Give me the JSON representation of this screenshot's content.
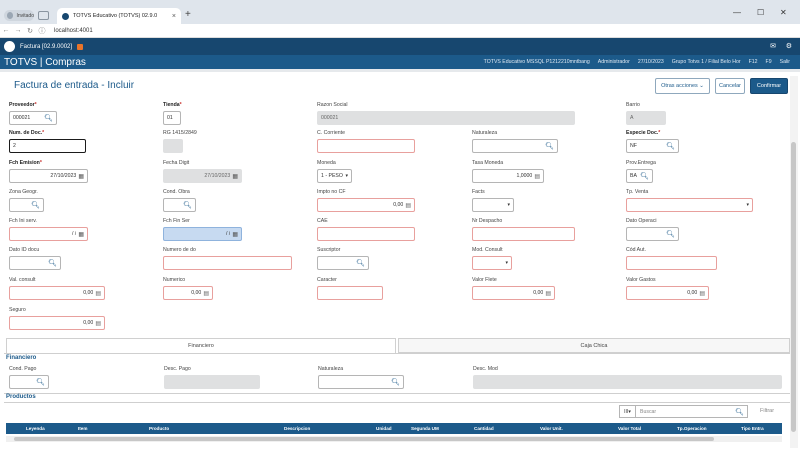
{
  "browser": {
    "profile_label": "Invitado",
    "tab_title": "TOTVS Educativo (TOTVS) 02.9.0",
    "tab_close": "×",
    "new_tab": "+",
    "url": "localhost:4001"
  },
  "app": {
    "window_title": "Factura [02.9.0002]",
    "brand": "TOTVS | Compras",
    "env_info": [
      "TOTVS Educativo MSSQL P1212210mntbang",
      "Administrador",
      "27/10/2023",
      "Grupo Totvs 1 / Filial Belo Hor",
      "F12",
      "F9",
      "Salir"
    ]
  },
  "page": {
    "title": "Factura de entrada - Incluir",
    "buttons": {
      "more_actions": "Otras acciones",
      "cancel": "Cancelar",
      "confirm": "Confirmar"
    }
  },
  "form": {
    "proveedor": {
      "label": "Proveedor",
      "value": "000021"
    },
    "tienda": {
      "label": "Tienda",
      "value": "01"
    },
    "razon_social": {
      "label": "Razon Social",
      "value": "000021"
    },
    "barrio": {
      "label": "Barrio",
      "value": "A"
    },
    "num_doc": {
      "label": "Num. de Doc.",
      "value": "2"
    },
    "rg": {
      "label": "RG 1415/2849",
      "value": ""
    },
    "c_corriente": {
      "label": "C. Corriente",
      "value": ""
    },
    "naturaleza": {
      "label": "Naturaleza",
      "value": ""
    },
    "especie_doc": {
      "label": "Especie Doc.",
      "value": "NF"
    },
    "fch_emision": {
      "label": "Fch Emision",
      "value": "27/10/2023"
    },
    "fecha_digit": {
      "label": "Fecha Digit",
      "value": "27/10/2023"
    },
    "moneda": {
      "label": "Moneda",
      "value": "1 - PESO"
    },
    "tasa_moneda": {
      "label": "Tasa Moneda",
      "value": "1,0000"
    },
    "prov_entrega": {
      "label": "Prov.Entrega",
      "value": "BA"
    },
    "zona_geogr": {
      "label": "Zona Geogr.",
      "value": ""
    },
    "cond_obra": {
      "label": "Cond.  Obra",
      "value": ""
    },
    "impto_no_cf": {
      "label": "Impto no CF",
      "value": "0,00"
    },
    "facts": {
      "label": "Facts",
      "value": ""
    },
    "tp_venta": {
      "label": "Tp. Venta",
      "value": ""
    },
    "fch_ini_serv": {
      "label": "Fch Ini serv.",
      "value": "/  /"
    },
    "fch_fin_ser": {
      "label": "Fch Fin Ser",
      "value": "/  /"
    },
    "cae": {
      "label": "CAE",
      "value": ""
    },
    "nr_despacho": {
      "label": "Nr Despacho",
      "value": ""
    },
    "dato_operaci": {
      "label": "Dato Operaci",
      "value": ""
    },
    "dato_id_docu": {
      "label": "Dato ID docu",
      "value": ""
    },
    "numero_de_do": {
      "label": "Numero de do",
      "value": ""
    },
    "suscriptor": {
      "label": "Suscriptor",
      "value": ""
    },
    "mod_consult": {
      "label": "Mod. Consult",
      "value": ""
    },
    "cod_aut": {
      "label": "Cód Aut.",
      "value": ""
    },
    "val_consult": {
      "label": "Val. consult",
      "value": "0,00"
    },
    "numerico": {
      "label": "Numerico",
      "value": "0,00"
    },
    "caracter": {
      "label": "Caracter",
      "value": ""
    },
    "valor_flete": {
      "label": "Valor Flete",
      "value": "0,00"
    },
    "valor_gastos": {
      "label": "Valor Gastos",
      "value": "0,00"
    },
    "seguro": {
      "label": "Seguro",
      "value": "0,00"
    }
  },
  "tabs": {
    "financiero": "Financiero",
    "caja_chica": "Caja Chica"
  },
  "financiero": {
    "title": "Financiero",
    "cond_pago": {
      "label": "Cond. Pago",
      "value": ""
    },
    "desc_pago": {
      "label": "Desc. Pago",
      "value": ""
    },
    "naturaleza": {
      "label": "Naturaleza",
      "value": ""
    },
    "desc_mod": {
      "label": "Desc. Mod",
      "value": ""
    }
  },
  "productos": {
    "title": "Productos",
    "grid_select": "III",
    "search_placeholder": "Buscar",
    "filter_label": "Filtrar",
    "columns": [
      "Leyenda",
      "Item",
      "Producto",
      "Descripcion",
      "Unidad",
      "Segunda UM",
      "Cantidad",
      "Valor Unit.",
      "Valor Total",
      "Tp.Operacion",
      "Tipo Entra"
    ]
  },
  "colors": {
    "header_dark": "#17476f",
    "header": "#1c5a8a",
    "error_border": "#e8a09d",
    "disabled": "#dfe0e1"
  },
  "icons": [
    "search-icon",
    "calendar-icon",
    "calculator-icon",
    "chevron-down-icon",
    "close-icon",
    "menu-icon"
  ]
}
